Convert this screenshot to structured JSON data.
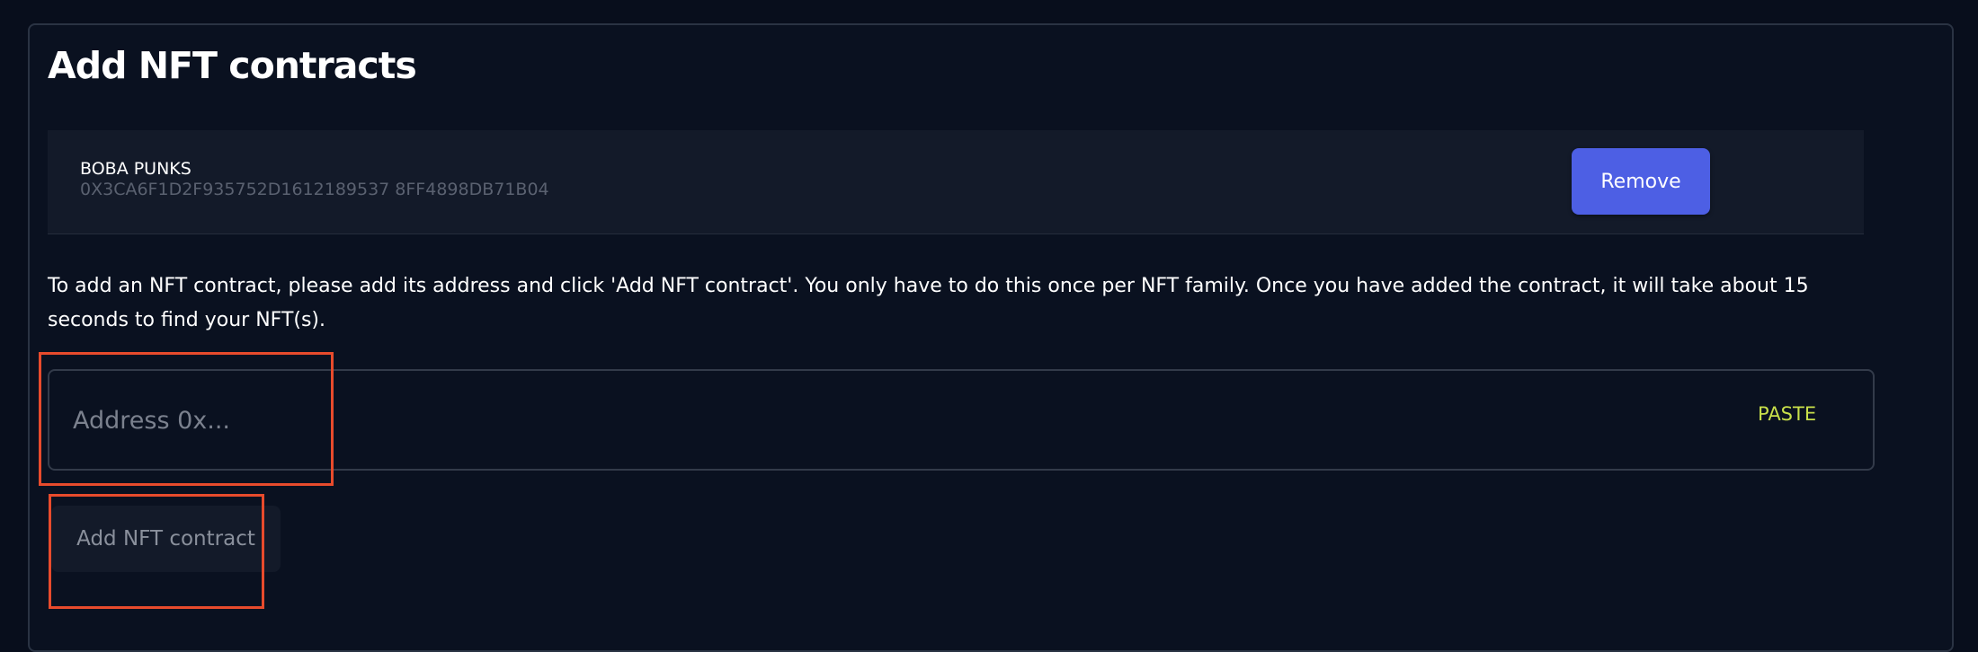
{
  "page": {
    "title": "Add NFT contracts"
  },
  "contracts": [
    {
      "name": "BOBA PUNKS",
      "address": "0X3CA6F1D2F935752D1612189537 8FF4898DB71B04",
      "remove_label": "Remove"
    }
  ],
  "help_text": "To add an NFT contract, please add its address and click 'Add NFT contract'. You only have to do this once per NFT family. Once you have added the contract, it will take about 15 seconds to find your NFT(s).",
  "address_input": {
    "value": "",
    "placeholder": "Address 0x...",
    "paste_label": "PASTE"
  },
  "add_button": {
    "label": "Add NFT contract",
    "disabled": true
  },
  "colors": {
    "background": "#080e1c",
    "accent": "#4d5fe4",
    "paste": "#c8df4a",
    "highlight": "#e84b2c"
  }
}
